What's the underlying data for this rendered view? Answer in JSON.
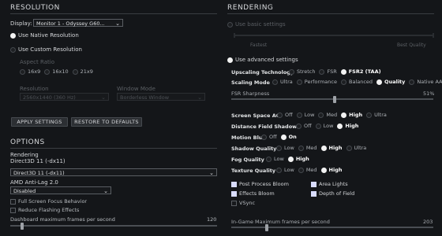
{
  "resolution": {
    "title": "RESOLUTION",
    "display_label": "Display:",
    "display_value": "Monitor 1 - Odyssey G60...",
    "use_native": "Use Native Resolution",
    "use_custom": "Use Custom Resolution",
    "aspect_ratio_label": "Aspect Ratio",
    "aspect_options": [
      "16x9",
      "16x10",
      "21x9"
    ],
    "resolution_label": "Resolution",
    "resolution_value": "2560x1440 (360 Hz)",
    "window_mode_label": "Window Mode",
    "window_mode_value": "Borderless Window",
    "apply_label": "APPLY SETTINGS",
    "restore_label": "RESTORE TO DEFAULTS"
  },
  "options": {
    "title": "OPTIONS",
    "rendering_label": "Rendering",
    "rendering_current": "Direct3D 11 (-dx11)",
    "rendering_value": "Direct3D 11 (-dx11)",
    "anti_lag_label": "AMD Anti-Lag 2.0",
    "anti_lag_value": "Disabled",
    "full_screen_focus": "Full Screen Focus Behavior",
    "reduce_flashing": "Reduce Flashing Effects",
    "dashboard_fps_label": "Dashboard maximum frames per second",
    "dashboard_fps_value": "120",
    "dashboard_fps_fraction": 0.05
  },
  "rendering": {
    "title": "RENDERING",
    "use_basic": "Use basic settings",
    "basic_left": "Fastest",
    "basic_right": "Best Quality",
    "use_advanced": "Use advanced settings",
    "upscaling_label": "Upscaling Technology",
    "upscaling_options": [
      "Stretch",
      "FSR",
      "FSR2 (TAA)"
    ],
    "upscaling_selected": 2,
    "scaling_label": "Scaling Mode",
    "scaling_options": [
      "Ultra",
      "Performance",
      "Balanced",
      "Quality",
      "Native AA"
    ],
    "scaling_selected": 3,
    "sharpness_label": "FSR Sharpness",
    "sharpness_value": "51%",
    "sharpness_fraction": 0.51,
    "ssao_label": "Screen Space AO",
    "ssao_options": [
      "Off",
      "Low",
      "Med",
      "High",
      "Ultra"
    ],
    "ssao_selected": 3,
    "dfs_label": "Distance Field Shadows",
    "dfs_options": [
      "Off",
      "Low",
      "High"
    ],
    "dfs_selected": 2,
    "motion_label": "Motion Blur",
    "motion_options": [
      "Off",
      "On"
    ],
    "motion_selected": 1,
    "shadow_label": "Shadow Quality",
    "shadow_options": [
      "Low",
      "Med",
      "High",
      "Ultra"
    ],
    "shadow_selected": 2,
    "fog_label": "Fog Quality",
    "fog_options": [
      "Low",
      "High"
    ],
    "fog_selected": 1,
    "texture_label": "Texture Quality",
    "texture_options": [
      "Low",
      "Med",
      "High"
    ],
    "texture_selected": 2,
    "post_bloom": "Post Process Bloom",
    "area_lights": "Area Lights",
    "effects_bloom": "Effects Bloom",
    "depth_of_field": "Depth of Field",
    "vsync": "VSync",
    "ingame_fps_label": "In-Game Maximum frames per second",
    "ingame_fps_value": "203",
    "ingame_fps_fraction": 0.17
  }
}
